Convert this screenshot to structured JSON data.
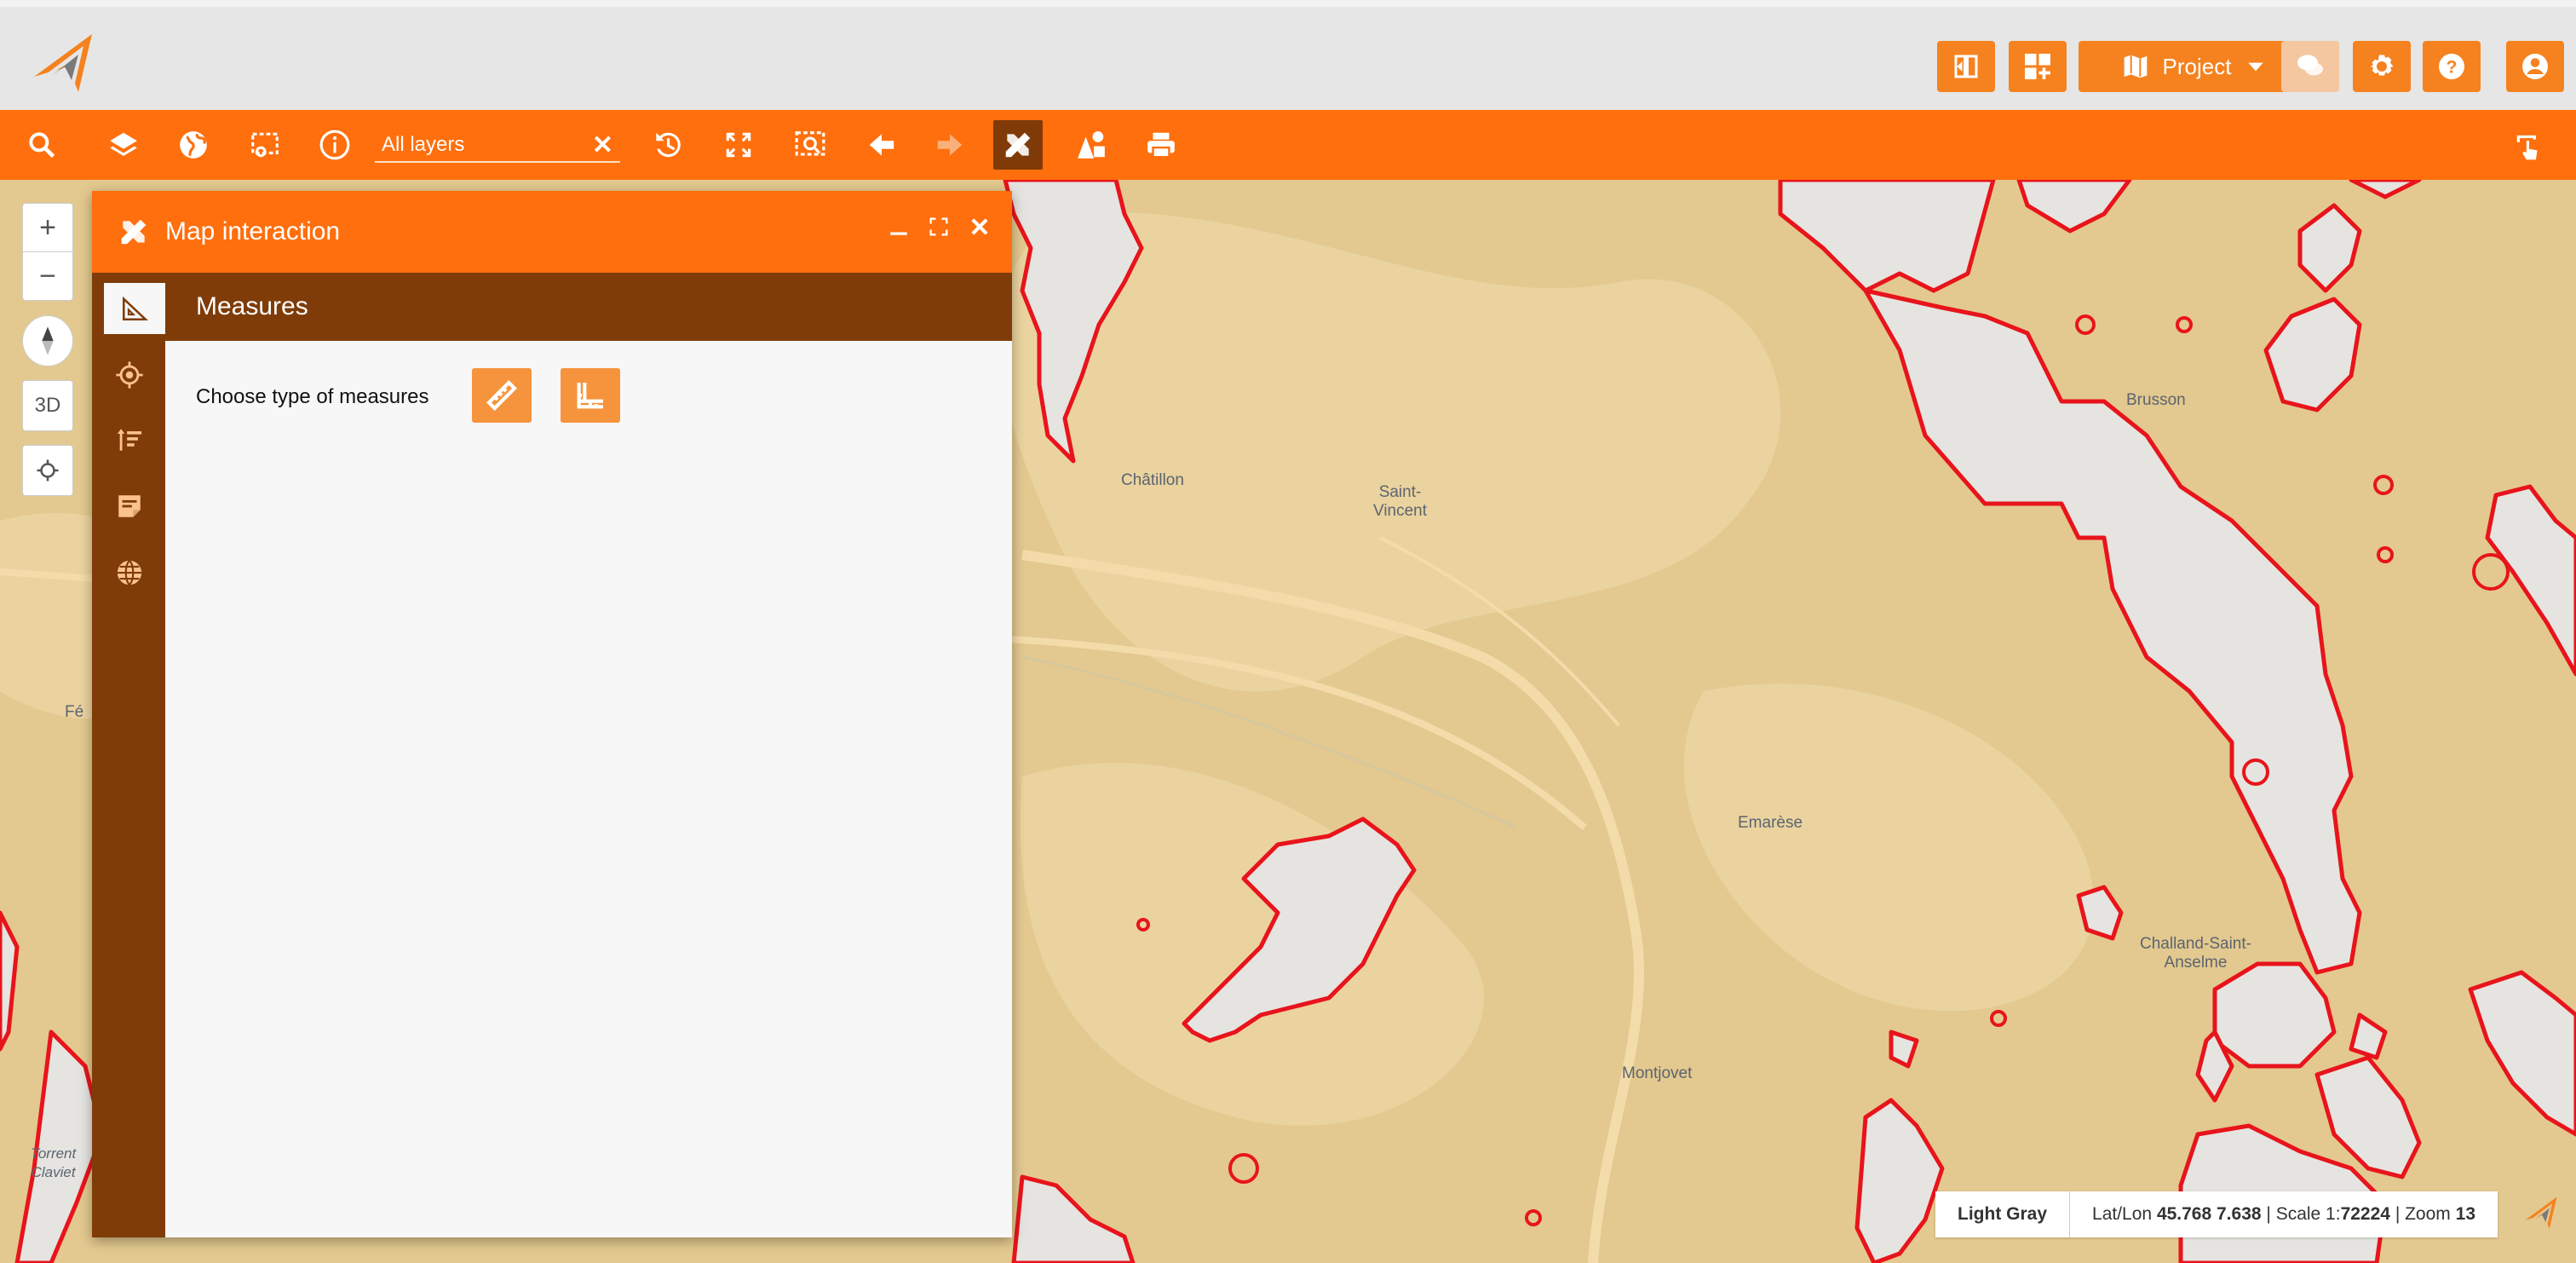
{
  "header": {
    "project_label": "Project"
  },
  "toolbar": {
    "layer_search_value": "All layers",
    "clear_symbol": "✕"
  },
  "map": {
    "zoom_in": "+",
    "zoom_out": "−",
    "mode_3d": "3D",
    "places": [
      {
        "name": "Brusson"
      },
      {
        "name": "Châtillon"
      },
      {
        "name": "Saint-\nVincent"
      },
      {
        "name": "Emarèse"
      },
      {
        "name": "Challand-Saint-\nAnselme"
      },
      {
        "name": "Montjovet"
      },
      {
        "name": "Fé"
      },
      {
        "name": "Torrent\nClaviet"
      }
    ]
  },
  "panel": {
    "title": "Map interaction",
    "section": "Measures",
    "choose_label": "Choose type of measures"
  },
  "status": {
    "basemap": "Light Gray",
    "latlon_label": "Lat/Lon",
    "latlon_value": "45.768 7.638",
    "scale_label": "Scale 1:",
    "scale_value": "72224",
    "zoom_label": "Zoom",
    "zoom_value": "13"
  },
  "colors": {
    "accent": "#ff6f0d",
    "panel_dark": "#7f3c08",
    "button_orange": "#f5821f",
    "map_base": "#e3c98f",
    "boundary_red": "#e8141c"
  }
}
